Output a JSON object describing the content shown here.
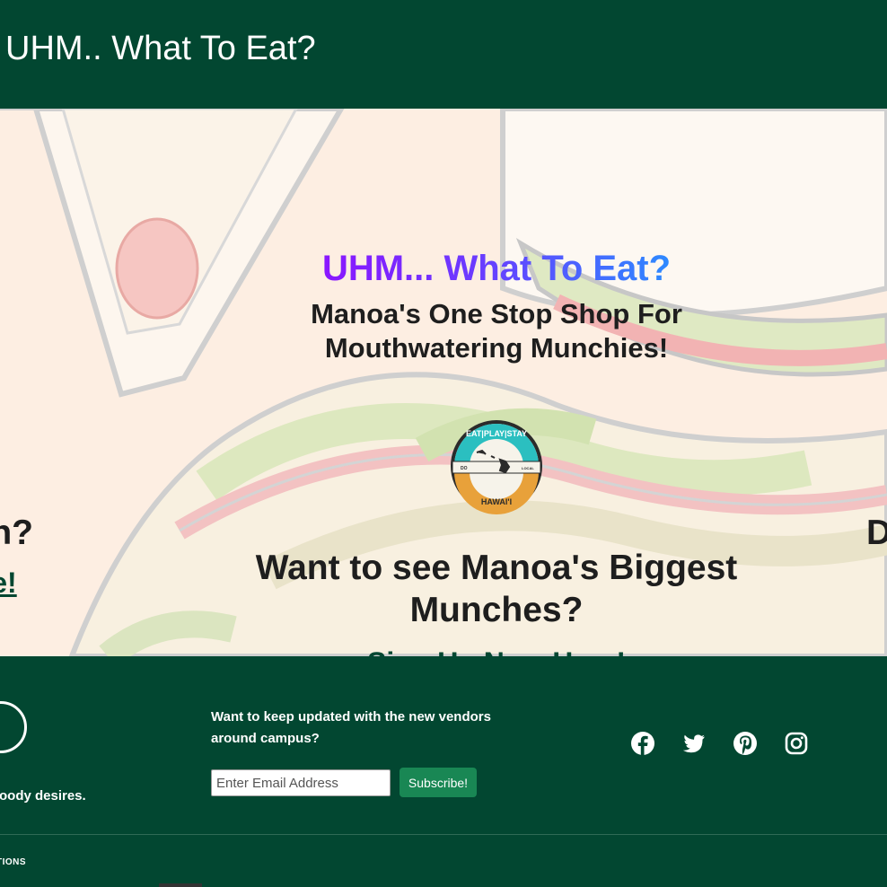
{
  "header": {
    "brand": "UHM.. What To Eat?"
  },
  "hero": {
    "title": "UHM... What To Eat?",
    "subtitle": "Manoa's One Stop Shop For Mouthwatering Munchies!",
    "badge": {
      "top_text": "EAT|PLAY|STAY",
      "left_text": "DO",
      "right_text": "LOCAL",
      "bottom_text": "HAWAI'I"
    },
    "center_question": "Want to see Manoa's Biggest Munches?",
    "center_link": "Sign Up Now Here!",
    "left_question": "unch?",
    "left_link": "ere!",
    "right_question": "D",
    "right_link": ""
  },
  "footer": {
    "tagline": "foody desires.",
    "signup_prompt": "Want to keep updated with the new vendors around campus?",
    "email_placeholder": "Enter Email Address",
    "subscribe_label": "Subscribe!",
    "social": [
      {
        "name": "facebook-icon"
      },
      {
        "name": "twitter-icon"
      },
      {
        "name": "pinterest-icon"
      },
      {
        "name": "instagram-icon"
      }
    ],
    "bottom_link": "TIONS"
  },
  "colors": {
    "header_bg": "#024731",
    "hero_bg": "#fdeee2",
    "link": "#024731",
    "subscribe_bg": "#198754",
    "badge_teal": "#2bbfc0",
    "badge_orange": "#e8a13a"
  }
}
